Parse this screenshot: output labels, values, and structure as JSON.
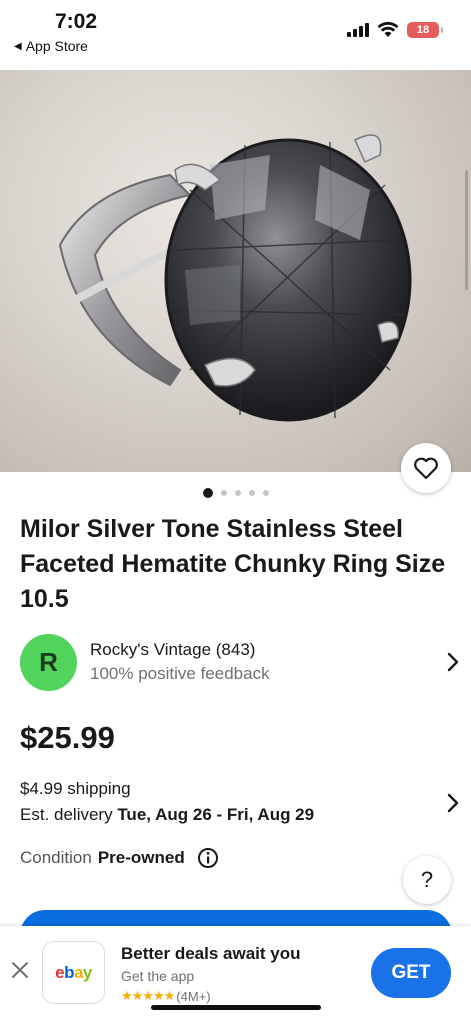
{
  "status_bar": {
    "time": "7:02",
    "back_label": "App Store",
    "battery": "18"
  },
  "product": {
    "title": "Milor Silver Tone Stainless Steel Faceted Hematite Chunky Ring Size 10.5",
    "image_count": 5,
    "active_image_index": 0
  },
  "seller": {
    "avatar_letter": "R",
    "name": "Rocky's Vintage (843)",
    "feedback": "100% positive feedback"
  },
  "price": "$25.99",
  "shipping": {
    "cost": "$4.99 shipping",
    "delivery_prefix": "Est. delivery ",
    "delivery_dates": "Tue, Aug 26 - Fri, Aug 29"
  },
  "condition": {
    "label": "Condition",
    "value": "Pre-owned"
  },
  "help_label": "?",
  "app_banner": {
    "title": "Better deals await you",
    "subtitle": "Get the app",
    "stars": "★★★★★",
    "reviews": "(4M+)",
    "get_label": "GET",
    "logo_letters": [
      "e",
      "b",
      "a",
      "y"
    ]
  },
  "colors": {
    "accent": "#1a72e8",
    "seller_avatar": "#52d35c",
    "star": "#f5af02"
  }
}
